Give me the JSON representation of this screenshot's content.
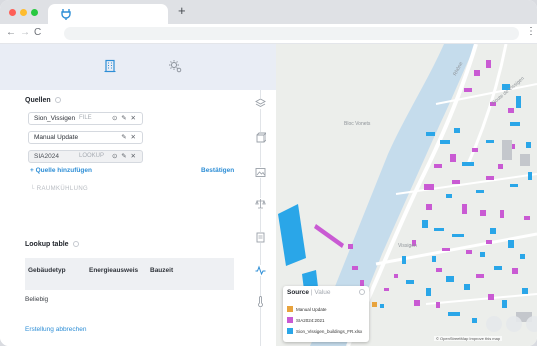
{
  "browser": {
    "new_tab_symbol": "+",
    "back_symbol": "←",
    "forward_symbol": "→",
    "reload_symbol": "C",
    "menu_symbol": "⋮"
  },
  "header_tabs": [
    {
      "icon": "building-icon",
      "active": true
    },
    {
      "icon": "sun-settings-icon",
      "active": false
    }
  ],
  "sources": {
    "title": "Quellen",
    "items": [
      {
        "name": "Sion_Vissigen",
        "type": "FILE",
        "actions": "⊙ ✎ ✕",
        "disabled": false
      },
      {
        "name": "Manual Update",
        "type": "",
        "actions": "✎ ✕",
        "disabled": false
      },
      {
        "name": "SIA2024",
        "type": "LOOKUP",
        "actions": "⊙ ✎ ✕",
        "disabled": true
      }
    ],
    "add_label": "+ Quelle hinzufügen",
    "confirm_label": "Bestätigen",
    "sub_item": "└ RAUMKÜHLUNG"
  },
  "lookup_table": {
    "title": "Lookup table",
    "columns": [
      "Gebäudetyp",
      "Energieausweis",
      "Bauzeit"
    ],
    "row_value": "Beliebig"
  },
  "cancel_label": "Erstellung abbrechen",
  "map": {
    "label_bloc": "Bloc Vonets",
    "label_river": "Rhône",
    "label_road": "Route de Vissigen",
    "label_street": "Vissigen"
  },
  "legend": {
    "title": "Source",
    "separator": " | ",
    "value_label": "Value",
    "items": [
      {
        "label": "Manual Update",
        "color": "#e8a33d"
      },
      {
        "label": "SIA2024:2021",
        "color": "#c95ad3"
      },
      {
        "label": "Sion_Vissigen_buildings_FR.xlsx",
        "color": "#2aa6e8"
      }
    ]
  },
  "attribution": "© OpenStreetMap Improve this map",
  "colors": {
    "accent": "#2d8ed6",
    "building_blue": "#2aa6e8",
    "building_magenta": "#c95ad3",
    "building_orange": "#e8a33d",
    "river": "#c5dcec"
  }
}
